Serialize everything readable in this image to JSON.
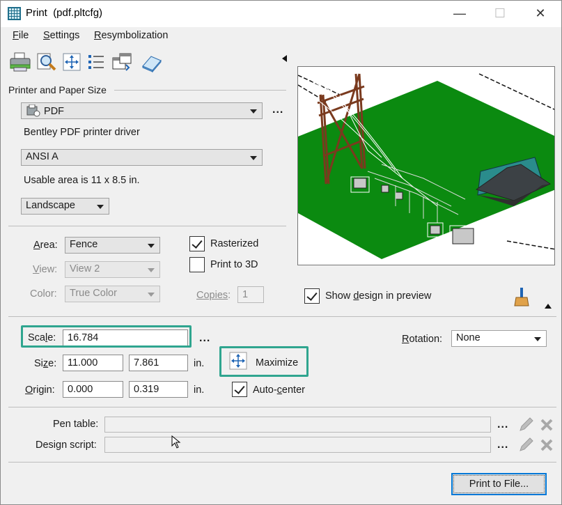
{
  "window": {
    "title": "Print",
    "subtitle": "(pdf.pltcfg)",
    "minimize_glyph": "—",
    "maximize_glyph": "☐",
    "close_glyph": "✕"
  },
  "menu": {
    "file": {
      "first": "F",
      "rest": "ile"
    },
    "settings": {
      "first": "S",
      "rest": "ettings"
    },
    "resymbolization": {
      "first": "R",
      "rest": "esymbolization"
    }
  },
  "toolbar": {
    "icons": [
      "printer-icon",
      "preview-icon",
      "fit-view-icon",
      "list-icon",
      "copy-windows-icon",
      "eraser-icon"
    ]
  },
  "printer": {
    "section_label": "Printer and Paper Size",
    "printer_name": "PDF",
    "driver": "Bentley PDF printer driver",
    "paper": "ANSI A",
    "usable_area": "Usable area is 11 x 8.5 in.",
    "orientation": "Landscape",
    "more": "..."
  },
  "area": {
    "area_label": {
      "first": "A",
      "rest": "rea:"
    },
    "area_value": "Fence",
    "view_label": {
      "first": "V",
      "rest": "iew:"
    },
    "view_value": "View 2",
    "color_label": "Color:",
    "color_value": "True Color",
    "rasterized_label": "Rasterized",
    "rasterized_checked": true,
    "print3d_label": "Print to 3D",
    "print3d_checked": false,
    "copies_label": {
      "first": "Copies",
      "rest": ":"
    },
    "copies_value": "1"
  },
  "preview": {
    "show_label_pre": "Show ",
    "show_label_u": "d",
    "show_label_post": "esign in preview",
    "show_checked": true
  },
  "scale": {
    "scale_label": {
      "pre": "Sca",
      "u": "l",
      "post": "e:"
    },
    "scale_value": "16.784",
    "more": "...",
    "rotation_label": {
      "first": "R",
      "rest": "otation:"
    },
    "rotation_value": "None",
    "size_label": {
      "pre": "Si",
      "u": "z",
      "post": "e:"
    },
    "size_w": "11.000",
    "size_h": "7.861",
    "size_unit": "in.",
    "maximize_label": "Maximize",
    "origin_label": {
      "first": "O",
      "rest": "rigin:"
    },
    "origin_x": "0.000",
    "origin_y": "0.319",
    "origin_unit": "in.",
    "autocenter_label": {
      "pre": "Auto-",
      "u": "c",
      "post": "enter"
    },
    "autocenter_checked": true
  },
  "tables": {
    "pen_table_label": "Pen table:",
    "pen_table_value": "",
    "design_script_label": "Design script:",
    "design_script_value": "",
    "more": "..."
  },
  "actions": {
    "print_to_file": "Print to File..."
  },
  "colors": {
    "accent_teal": "#2fa58f",
    "ground_green": "#0b8a10",
    "tower_brown": "#7a3a1e",
    "building_teal": "#2a8c8c",
    "roof_gray": "#3c4145"
  }
}
